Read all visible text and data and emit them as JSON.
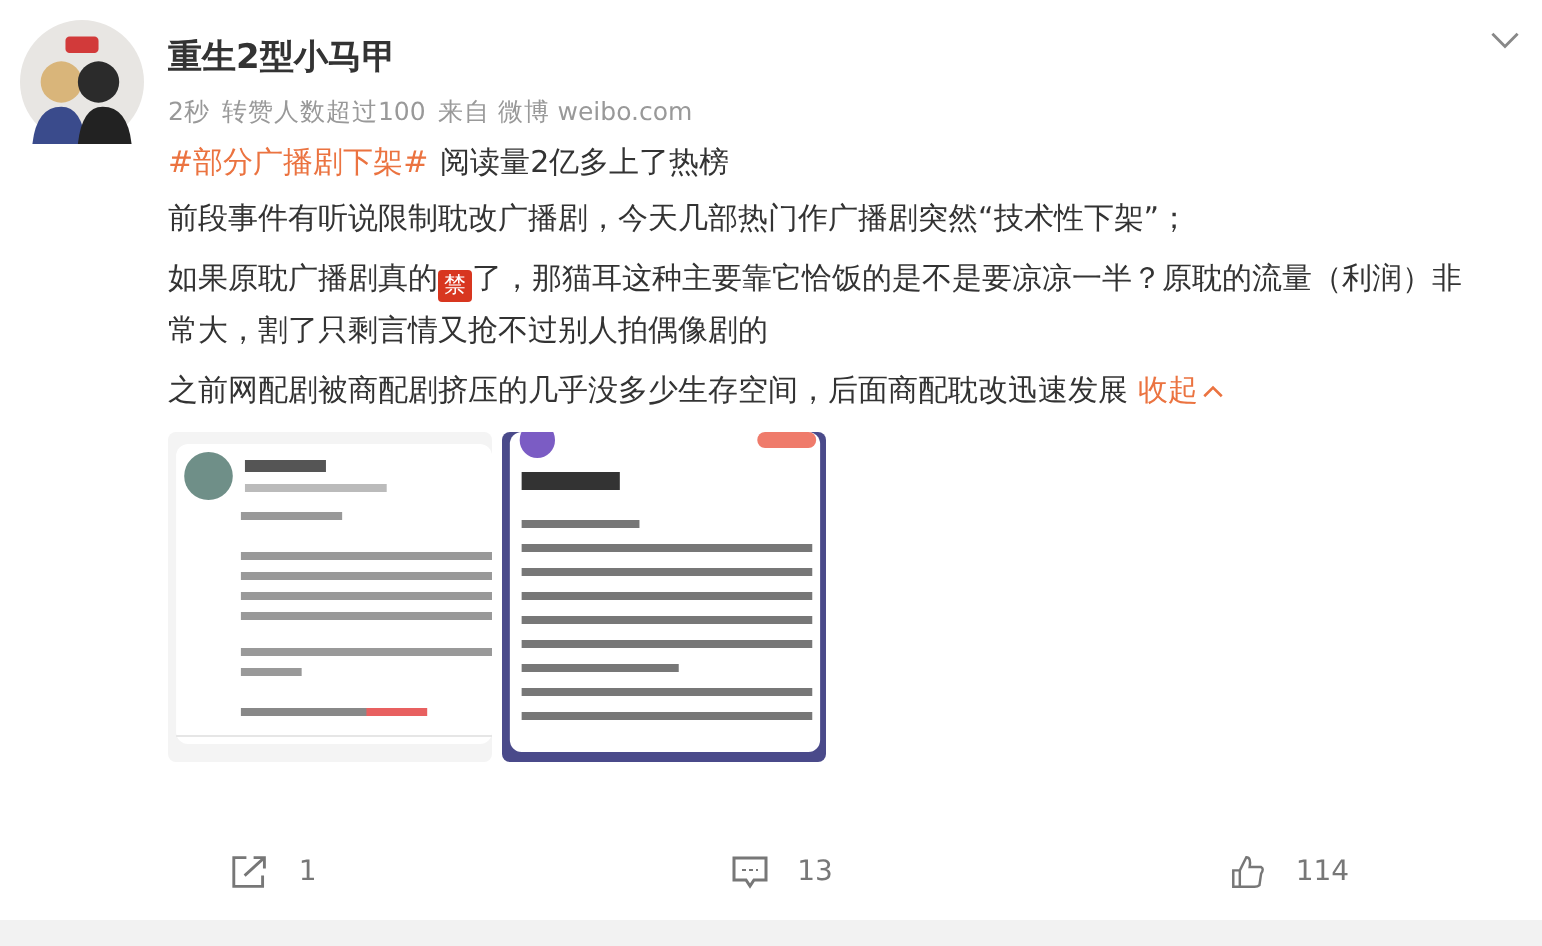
{
  "post": {
    "author": "重生2型小马甲",
    "meta": [
      {
        "text": "2秒"
      },
      {
        "text": "转赞人数超过100"
      },
      {
        "text": "来自 微博 weibo.com"
      }
    ],
    "topic_line": {
      "topic": "#部分广播剧下架#",
      "text": "阅读量2亿多上了热榜"
    },
    "paragraphs": [
      {
        "before": "前段事件有听说限制耽改广播剧，今天几部热门作广播剧突然“技术性下架”；"
      },
      {
        "before": "如果原耽广播剧真的",
        "emoji": "禁",
        "after": "了，那猫耳这种主要靠它恰饭的是不是要凉凉一半？原耽的流量（利润）非常大，割了只剩言情又抢不过别人拍偶像剧的"
      },
      {
        "before": "之前网配剧被商配剧挤压的几乎没多少生存空间，后面商配耽改迅速发展",
        "link": "收起"
      }
    ],
    "actions": [
      {
        "kind": "share",
        "count": "1"
      },
      {
        "kind": "comment",
        "count": "13"
      },
      {
        "kind": "like",
        "count": "114"
      }
    ]
  }
}
